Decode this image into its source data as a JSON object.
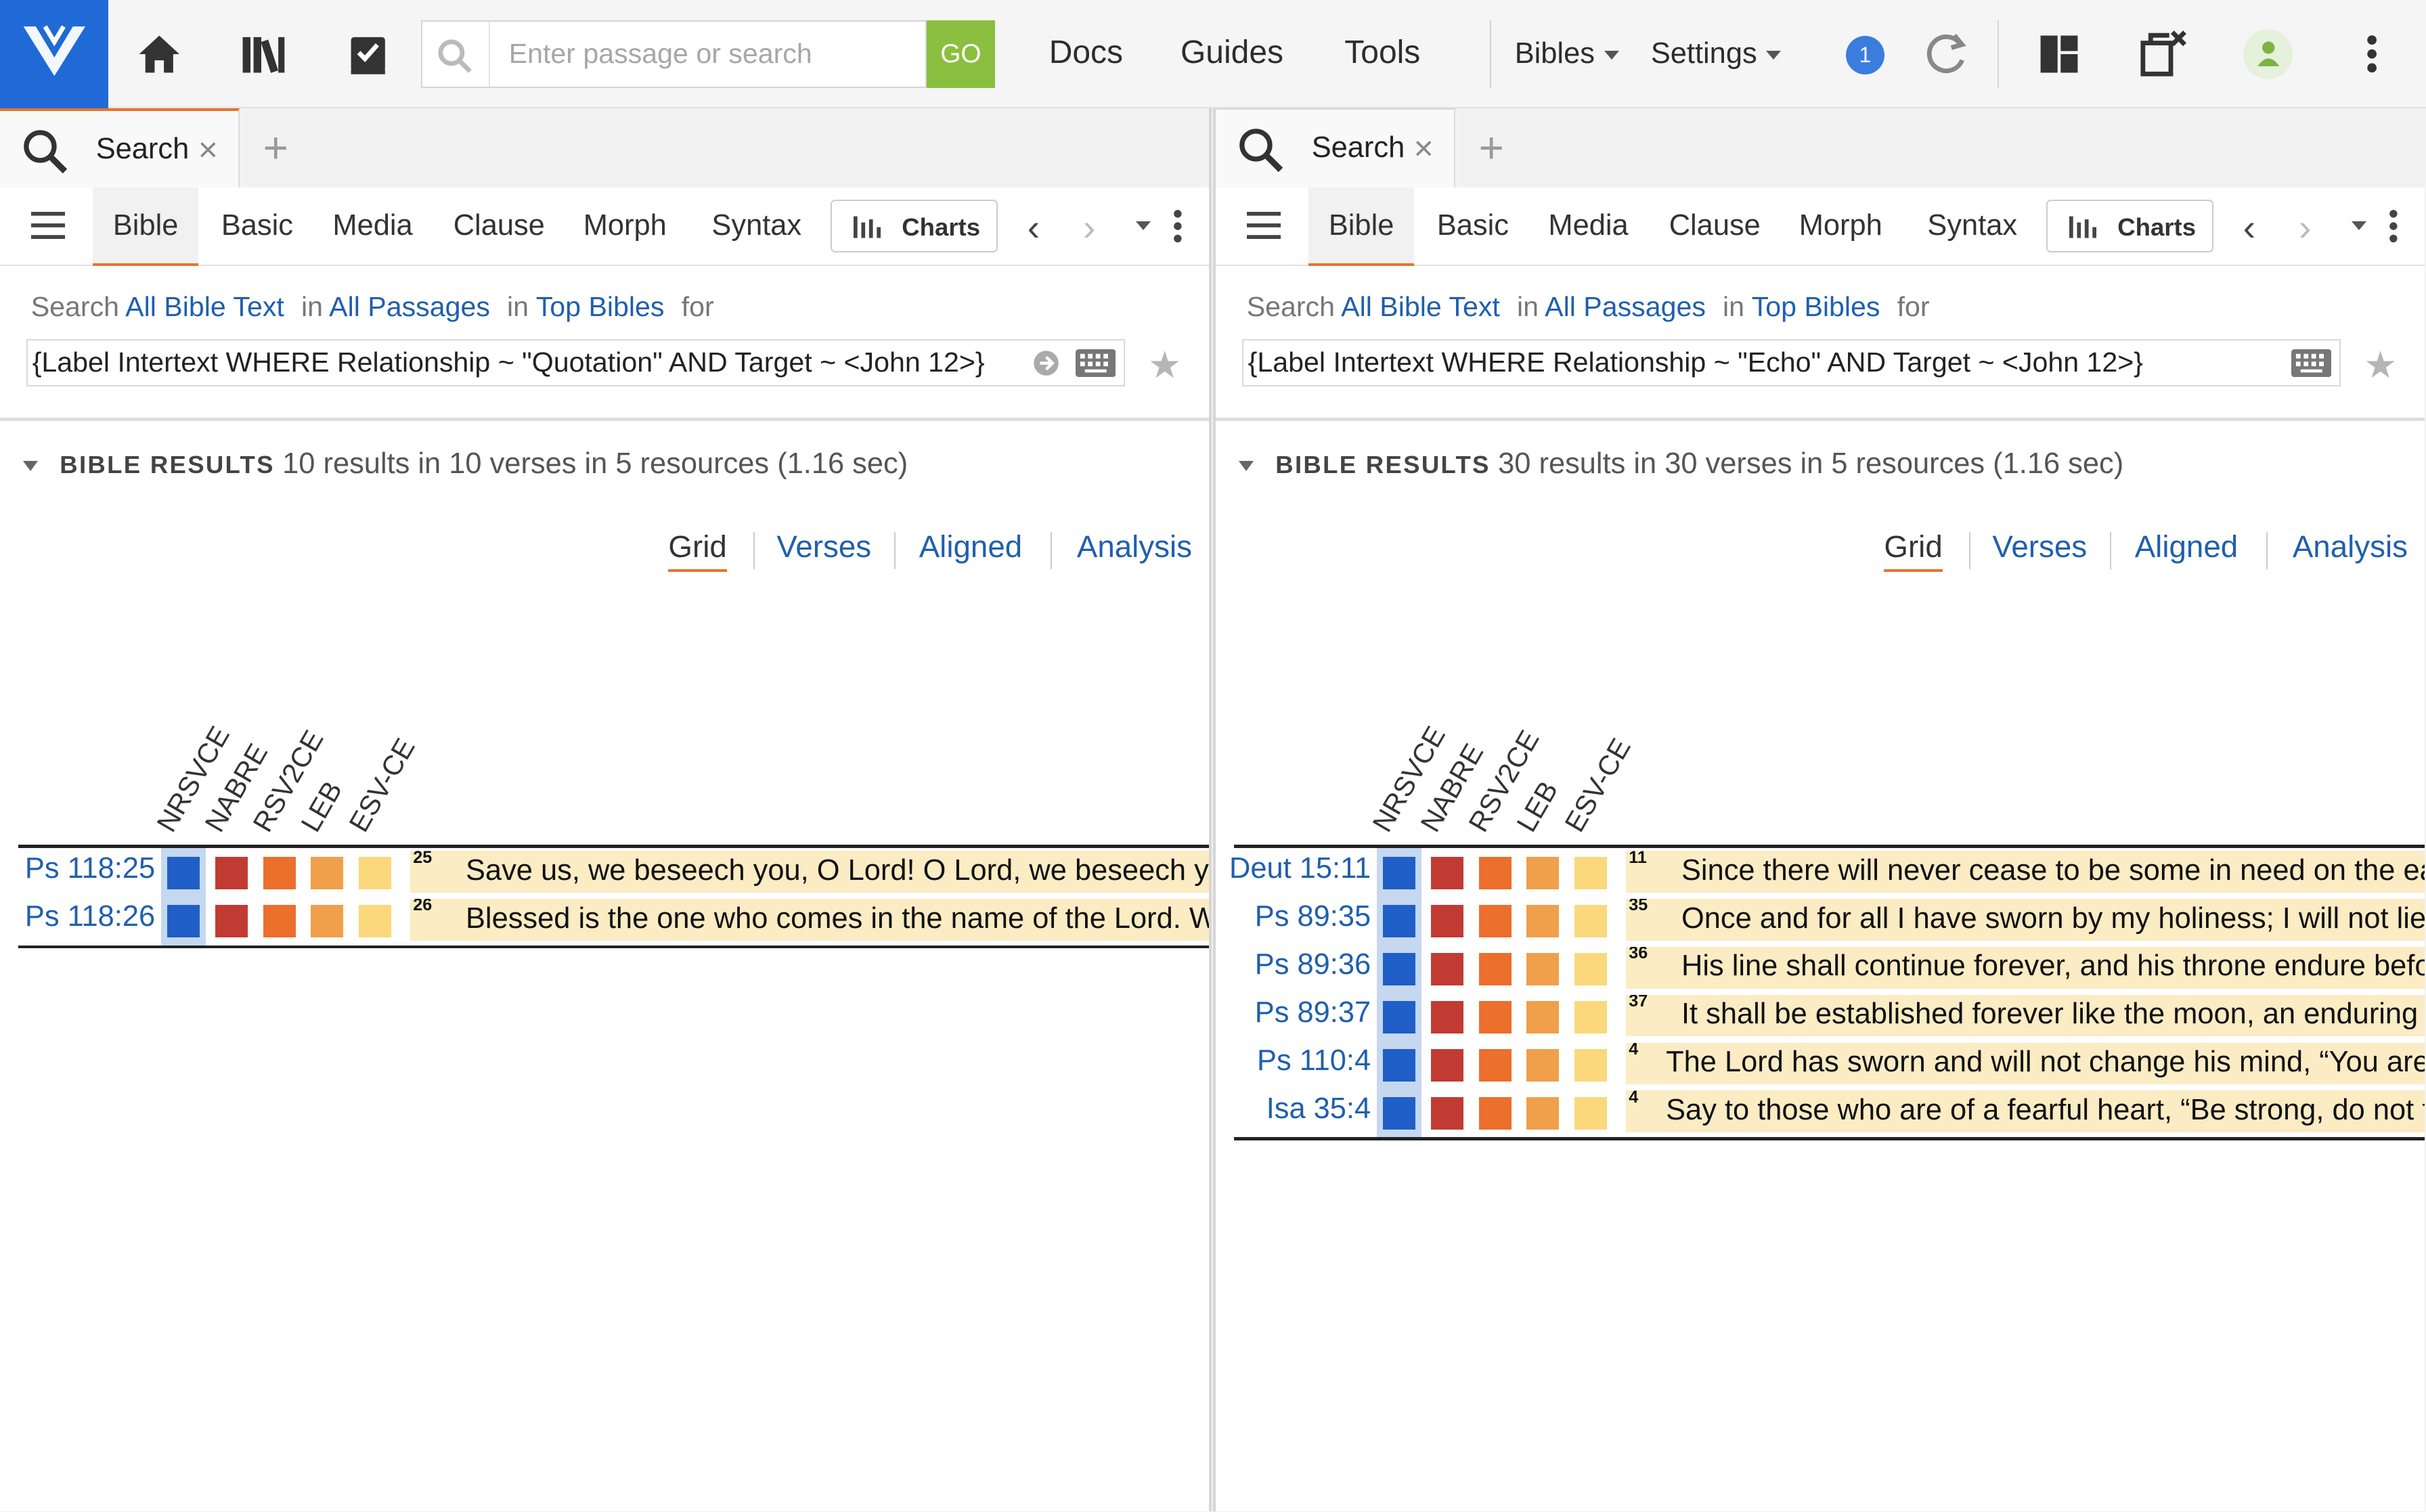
{
  "toolbar": {
    "search_placeholder": "Enter passage or search",
    "go_label": "GO",
    "nav": [
      "Docs",
      "Guides",
      "Tools"
    ],
    "bibles_label": "Bibles",
    "settings_label": "Settings",
    "notification_count": "1"
  },
  "panels": [
    {
      "tab_label": "Search",
      "subtabs": [
        "Bible",
        "Basic",
        "Media",
        "Clause",
        "Morph",
        "Syntax"
      ],
      "charts_label": "Charts",
      "search_prefix": "Search",
      "scope_text": "All Bible Text",
      "in1": "in",
      "passages": "All Passages",
      "in2": "in",
      "resources": "Top Bibles",
      "for": "for",
      "query": "{Label Intertext WHERE Relationship ~ \"Quotation\" AND Target ~ <John 12>}",
      "results_title": "BIBLE RESULTS",
      "results_summary": "10 results in 10 verses in 5 resources (1.16 sec)",
      "views": [
        "Grid",
        "Verses",
        "Aligned",
        "Analysis"
      ],
      "columns": [
        "NRSVCE",
        "NABRE",
        "RSV2CE",
        "LEB",
        "ESV-CE"
      ],
      "column_colors": [
        "#1f5fc7",
        "#c23b33",
        "#ec6f2c",
        "#f0a04a",
        "#fcd87c"
      ],
      "rows": [
        {
          "ref": "Ps 118:25",
          "num": "25",
          "text": "Save us, we beseech you, O Lord! O Lord, we beseech you, give us success!"
        },
        {
          "ref": "Ps 118:26",
          "num": "26",
          "text": "Blessed is the one who comes in the name of the Lord. We bless you from the house of the Lord."
        }
      ]
    },
    {
      "tab_label": "Search",
      "subtabs": [
        "Bible",
        "Basic",
        "Media",
        "Clause",
        "Morph",
        "Syntax"
      ],
      "charts_label": "Charts",
      "search_prefix": "Search",
      "scope_text": "All Bible Text",
      "in1": "in",
      "passages": "All Passages",
      "in2": "in",
      "resources": "Top Bibles",
      "for": "for",
      "query": "{Label Intertext WHERE Relationship ~ \"Echo\" AND Target ~ <John 12>}",
      "results_title": "BIBLE RESULTS",
      "results_summary": "30 results in 30 verses in 5 resources (1.16 sec)",
      "views": [
        "Grid",
        "Verses",
        "Aligned",
        "Analysis"
      ],
      "columns": [
        "NRSVCE",
        "NABRE",
        "RSV2CE",
        "LEB",
        "ESV-CE"
      ],
      "column_colors": [
        "#1f5fc7",
        "#c23b33",
        "#ec6f2c",
        "#f0a04a",
        "#fcd87c"
      ],
      "rows": [
        {
          "ref": "Deut 15:11",
          "num": "11",
          "text": "Since there will never cease to be some in need on the earth, I therefore command you,"
        },
        {
          "ref": "Ps 89:35",
          "num": "35",
          "text": "Once and for all I have sworn by my holiness; I will not lie to David."
        },
        {
          "ref": "Ps 89:36",
          "num": "36",
          "text": "His line shall continue forever, and his throne endure before me like the sun."
        },
        {
          "ref": "Ps 89:37",
          "num": "37",
          "text": "It shall be established forever like the moon, an enduring witness in the skies."
        },
        {
          "ref": "Ps 110:4",
          "num": "4",
          "text": "The Lord has sworn and will not change his mind, “You are a priest forever”"
        },
        {
          "ref": "Isa 35:4",
          "num": "4",
          "text": "Say to those who are of a fearful heart, “Be strong, do not fear!”"
        }
      ]
    }
  ]
}
